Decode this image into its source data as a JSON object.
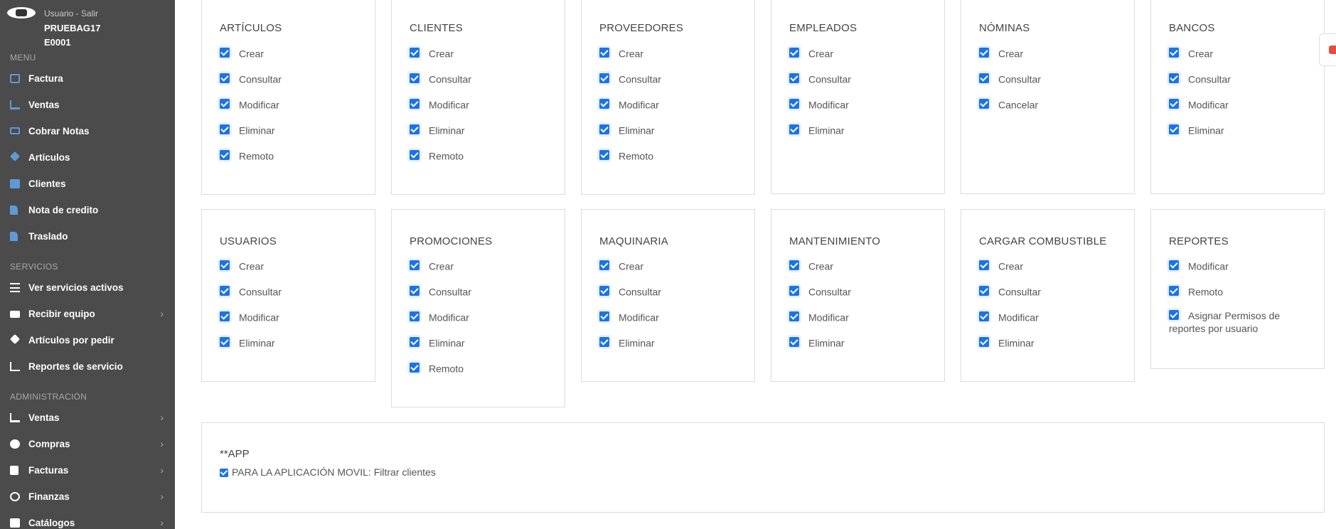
{
  "user": {
    "link_text": "Usuario - Salir",
    "username": "PRUEBAG17",
    "code": "E0001"
  },
  "sidebar": {
    "sections": [
      {
        "title": "MENU",
        "items": [
          {
            "label": "Factura",
            "icon": "invoice-icon"
          },
          {
            "label": "Ventas",
            "icon": "cart-icon"
          },
          {
            "label": "Cobrar Notas",
            "icon": "money-icon"
          },
          {
            "label": "Artículos",
            "icon": "tag-icon"
          },
          {
            "label": "Clientes",
            "icon": "address-book-icon"
          },
          {
            "label": "Nota de credito",
            "icon": "file-icon"
          },
          {
            "label": "Traslado",
            "icon": "file-icon"
          }
        ]
      },
      {
        "title": "SERVICIOS",
        "items": [
          {
            "label": "Ver servicios activos",
            "icon": "list-icon"
          },
          {
            "label": "Recibir equipo",
            "icon": "truck-icon"
          },
          {
            "label": "Artículos por pedir",
            "icon": "tags-icon"
          },
          {
            "label": "Reportes de servicio",
            "icon": "chart-icon"
          }
        ]
      },
      {
        "title": "ADMINISTRACIÓN",
        "items": [
          {
            "label": "Ventas",
            "icon": "cart-icon"
          },
          {
            "label": "Compras",
            "icon": "gear-icon"
          },
          {
            "label": "Facturas",
            "icon": "calculator-icon"
          },
          {
            "label": "Finanzas",
            "icon": "dollar-icon"
          },
          {
            "label": "Catálogos",
            "icon": "grid-icon"
          }
        ]
      }
    ]
  },
  "permission_cards": [
    {
      "title": "ARTÍCULOS",
      "perms": [
        "Crear",
        "Consultar",
        "Modificar",
        "Eliminar",
        "Remoto"
      ]
    },
    {
      "title": "CLIENTES",
      "perms": [
        "Crear",
        "Consultar",
        "Modificar",
        "Eliminar",
        "Remoto"
      ]
    },
    {
      "title": "PROVEEDORES",
      "perms": [
        "Crear",
        "Consultar",
        "Modificar",
        "Eliminar",
        "Remoto"
      ]
    },
    {
      "title": "EMPLEADOS",
      "perms": [
        "Crear",
        "Consultar",
        "Modificar",
        "Eliminar"
      ]
    },
    {
      "title": "NÓMINAS",
      "perms": [
        "Crear",
        "Consultar",
        "Cancelar"
      ]
    },
    {
      "title": "BANCOS",
      "perms": [
        "Crear",
        "Consultar",
        "Modificar",
        "Eliminar"
      ]
    },
    {
      "title": "USUARIOS",
      "perms": [
        "Crear",
        "Consultar",
        "Modificar",
        "Eliminar"
      ]
    },
    {
      "title": "PROMOCIONES",
      "perms": [
        "Crear",
        "Consultar",
        "Modificar",
        "Eliminar",
        "Remoto"
      ]
    },
    {
      "title": "MAQUINARIA",
      "perms": [
        "Crear",
        "Consultar",
        "Modificar",
        "Eliminar"
      ]
    },
    {
      "title": "MANTENIMIENTO",
      "perms": [
        "Crear",
        "Consultar",
        "Modificar",
        "Eliminar"
      ]
    },
    {
      "title": "CARGAR COMBUSTIBLE",
      "perms": [
        "Crear",
        "Consultar",
        "Modificar",
        "Eliminar"
      ]
    },
    {
      "title": "REPORTES",
      "perms": [
        "Modificar",
        "Remoto",
        "Asignar Permisos de reportes por usuario"
      ]
    }
  ],
  "app_section": {
    "title": "**APP",
    "perm_label": "PARA LA APLICACIÓN MOVIL: Filtrar clientes"
  }
}
